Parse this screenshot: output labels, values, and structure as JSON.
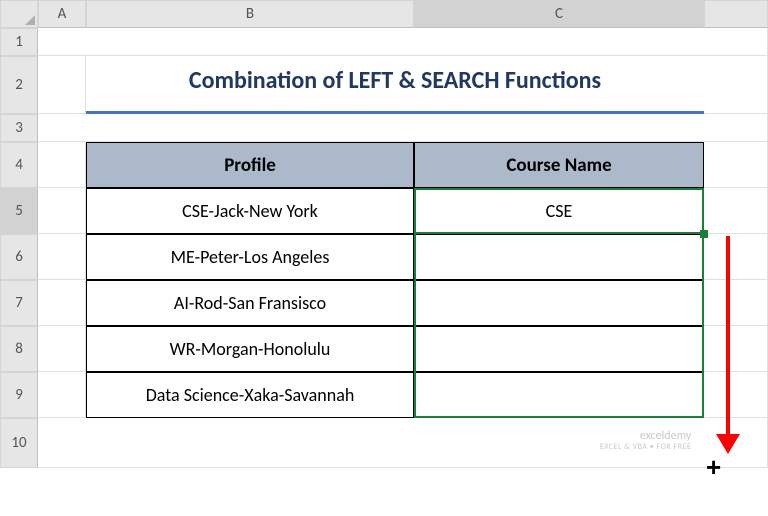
{
  "columns": [
    "A",
    "B",
    "C"
  ],
  "rows": [
    "1",
    "2",
    "3",
    "4",
    "5",
    "6",
    "7",
    "8",
    "9",
    "10"
  ],
  "title": "Combination of LEFT & SEARCH Functions",
  "headers": {
    "profile": "Profile",
    "course": "Course Name"
  },
  "data": [
    {
      "profile": "CSE-Jack-New York",
      "course": "CSE"
    },
    {
      "profile": "ME-Peter-Los Angeles",
      "course": ""
    },
    {
      "profile": "AI-Rod-San Fransisco",
      "course": ""
    },
    {
      "profile": "WR-Morgan-Honolulu",
      "course": ""
    },
    {
      "profile": "Data Science-Xaka-Savannah",
      "course": ""
    }
  ],
  "watermark": {
    "main": "exceldemy",
    "sub": "EXCEL & VBA • FOR FREE"
  },
  "active_column_index": 2,
  "active_row_index": 4
}
